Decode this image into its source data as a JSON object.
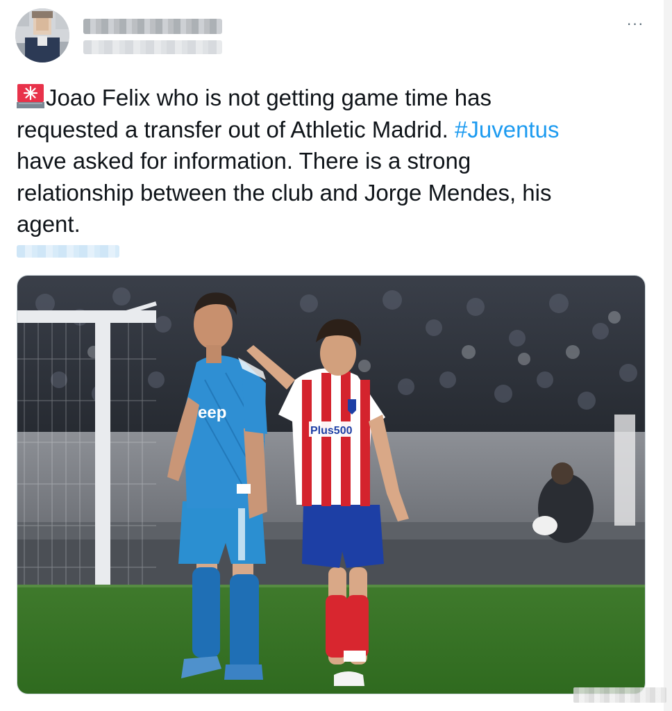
{
  "tweet": {
    "more_label": "···",
    "text_line1": "Joao Felix who is not getting game time has",
    "text_line2_before": "requested a transfer out of Athletic Madrid. ",
    "hashtag": "#Juventus",
    "text_line3": "have asked for information. There is a strong",
    "text_line4": "relationship between the club and Jorge Mendes, his",
    "text_line5": "agent."
  },
  "photo": {
    "jersey_sponsor_left": "eep",
    "jersey_sponsor_right": "Plus500"
  },
  "colors": {
    "hashtag": "#1d9bf0",
    "text": "#0f1419",
    "siren": "#e8324a"
  },
  "icons": {
    "siren": "rotating-light-icon",
    "more": "more-horizontal-icon"
  }
}
